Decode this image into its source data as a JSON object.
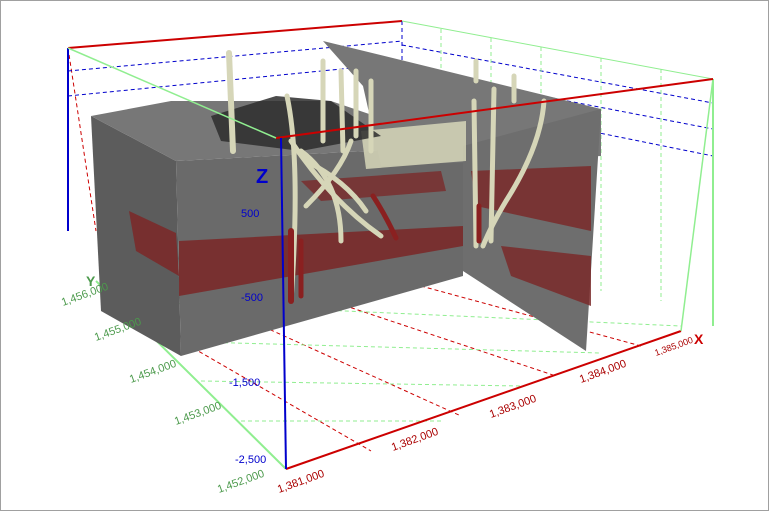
{
  "colors": {
    "x_axis": "#cc0000",
    "y_axis": "#4c9a4c",
    "z_axis": "#0000cc",
    "y_grid": "#90ee90",
    "geology_dark": "#5a5a5a",
    "geology_mid": "#6e6e6e",
    "red_layer": "#7a2a2a",
    "wells": "#d6d6b8",
    "well_red_segment": "#8a2020",
    "background": "#ffffff"
  },
  "axes": {
    "x": {
      "letter": "X",
      "ticks": [
        "1,381,000",
        "1,382,000",
        "1,383,000",
        "1,384,000",
        "1,385,000"
      ]
    },
    "y": {
      "letter": "Y",
      "ticks": [
        "1,452,000",
        "1,453,000",
        "1,454,000",
        "1,455,000",
        "1,456,000"
      ]
    },
    "z": {
      "letter": "Z",
      "ticks": [
        "500",
        "-500",
        "-1,500",
        "-2,500"
      ]
    }
  }
}
